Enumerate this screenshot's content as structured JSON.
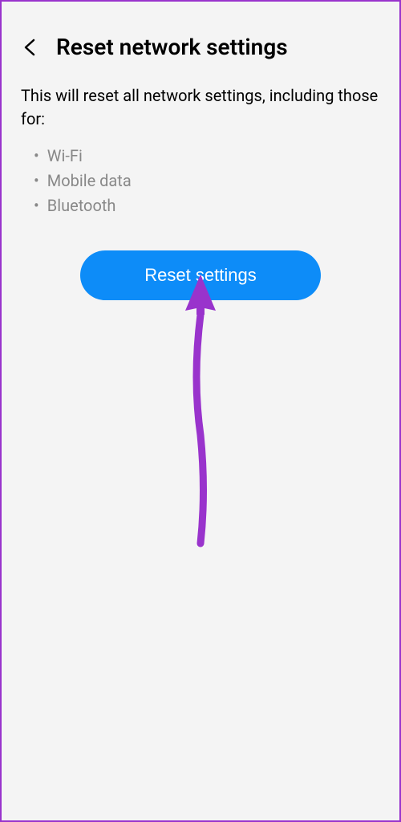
{
  "header": {
    "title": "Reset network settings"
  },
  "description": "This will reset all network settings, including those for:",
  "bullets": {
    "items": [
      "Wi-Fi",
      "Mobile data",
      "Bluetooth"
    ]
  },
  "button": {
    "label": "Reset settings"
  },
  "colors": {
    "primary": "#0d8cf8",
    "annotation": "#9933cc"
  }
}
